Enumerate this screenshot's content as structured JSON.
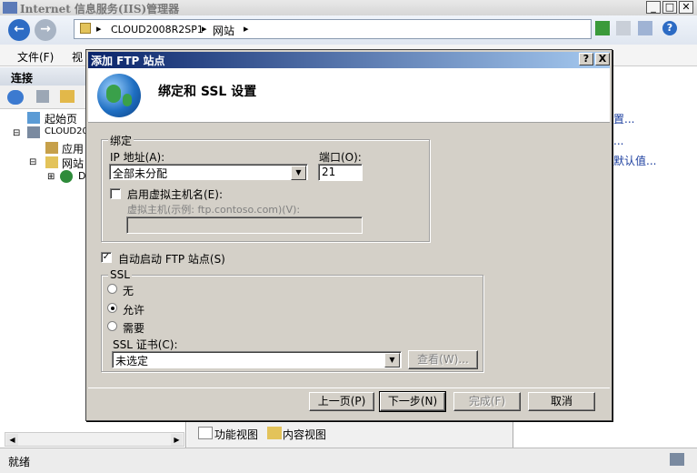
{
  "window": {
    "title": "Internet 信息服务(IIS)管理器"
  },
  "address": {
    "segments": [
      "CLOUD2008R2SP1",
      "网站"
    ]
  },
  "menu": {
    "file": "文件(F)",
    "view": "视"
  },
  "left_panel": {
    "header": "连接",
    "tree": [
      {
        "label": "起始页"
      },
      {
        "label": "CLOUD200"
      },
      {
        "label": "应用"
      },
      {
        "label": "网站"
      },
      {
        "label": "D"
      }
    ]
  },
  "right_panel": {
    "links": [
      "置...",
      "...",
      "默认值..."
    ]
  },
  "view_tabs": {
    "features": "功能视图",
    "content": "内容视图"
  },
  "status": {
    "text": "就绪"
  },
  "dialog": {
    "title": "添加 FTP 站点",
    "help_btn": "?",
    "close_btn": "X",
    "heading": "绑定和 SSL 设置",
    "binding": {
      "group_label": "绑定",
      "ip_label": "IP 地址(A):",
      "ip_value": "全部未分配",
      "port_label": "端口(O):",
      "port_value": "21",
      "vhost_check_label": "启用虚拟主机名(E):",
      "vhost_checked": false,
      "vhost_label": "虚拟主机(示例: ftp.contoso.com)(V):",
      "vhost_value": ""
    },
    "autostart": {
      "label": "自动启动 FTP 站点(S)",
      "checked": true
    },
    "ssl": {
      "group_label": "SSL",
      "options": [
        "无",
        "允许",
        "需要"
      ],
      "selected": "允许",
      "cert_label": "SSL 证书(C):",
      "cert_value": "未选定",
      "view_btn": "查看(W)..."
    },
    "buttons": {
      "prev": "上一页(P)",
      "next": "下一步(N)",
      "finish": "完成(F)",
      "cancel": "取消"
    }
  }
}
